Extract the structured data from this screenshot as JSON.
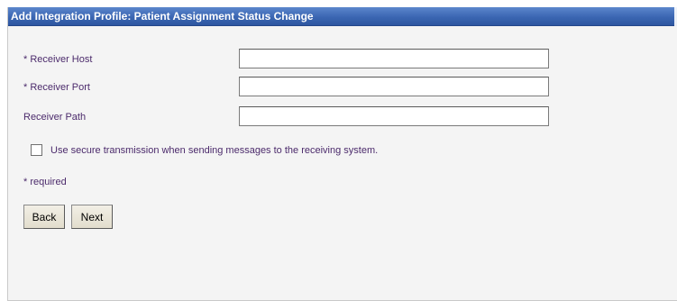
{
  "window": {
    "title": "Add Integration Profile: Patient Assignment Status Change"
  },
  "form": {
    "receiver_host": {
      "label": "* Receiver Host",
      "value": ""
    },
    "receiver_port": {
      "label": "* Receiver Port",
      "value": ""
    },
    "receiver_path": {
      "label": "Receiver Path",
      "value": ""
    },
    "secure": {
      "label": "Use secure transmission when sending messages to the receiving system.",
      "checked": false
    },
    "required_note": "* required"
  },
  "buttons": {
    "back": "Back",
    "next": "Next"
  },
  "colors": {
    "title_bar": "#3b66b2",
    "label_text": "#4b2a6b",
    "panel_bg": "#f4f4f4"
  }
}
